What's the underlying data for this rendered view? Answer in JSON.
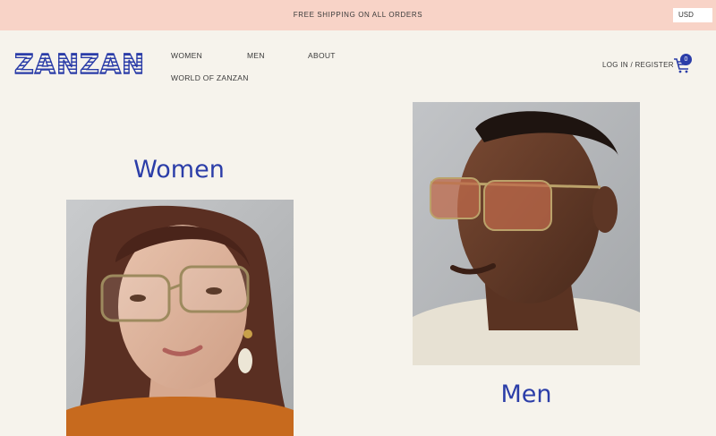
{
  "promo": {
    "text": "FREE SHIPPING ON ALL ORDERS"
  },
  "currency": {
    "selected": "USD"
  },
  "brand": {
    "logo_text": "ZANZAN",
    "color": "#2b3da8"
  },
  "nav": {
    "items": [
      {
        "label": "WOMEN"
      },
      {
        "label": "MEN"
      },
      {
        "label": "ABOUT"
      },
      {
        "label": "WORLD OF ZANZAN"
      }
    ]
  },
  "account": {
    "login_label": "LOG IN / REGISTER"
  },
  "cart": {
    "icon": "cart-icon",
    "count": "0"
  },
  "collections": {
    "women": {
      "heading": "Women"
    },
    "men": {
      "heading": "Men"
    }
  },
  "colors": {
    "background": "#f6f3ec",
    "promo_bar": "#f8d3c7",
    "accent": "#2b3da8"
  }
}
